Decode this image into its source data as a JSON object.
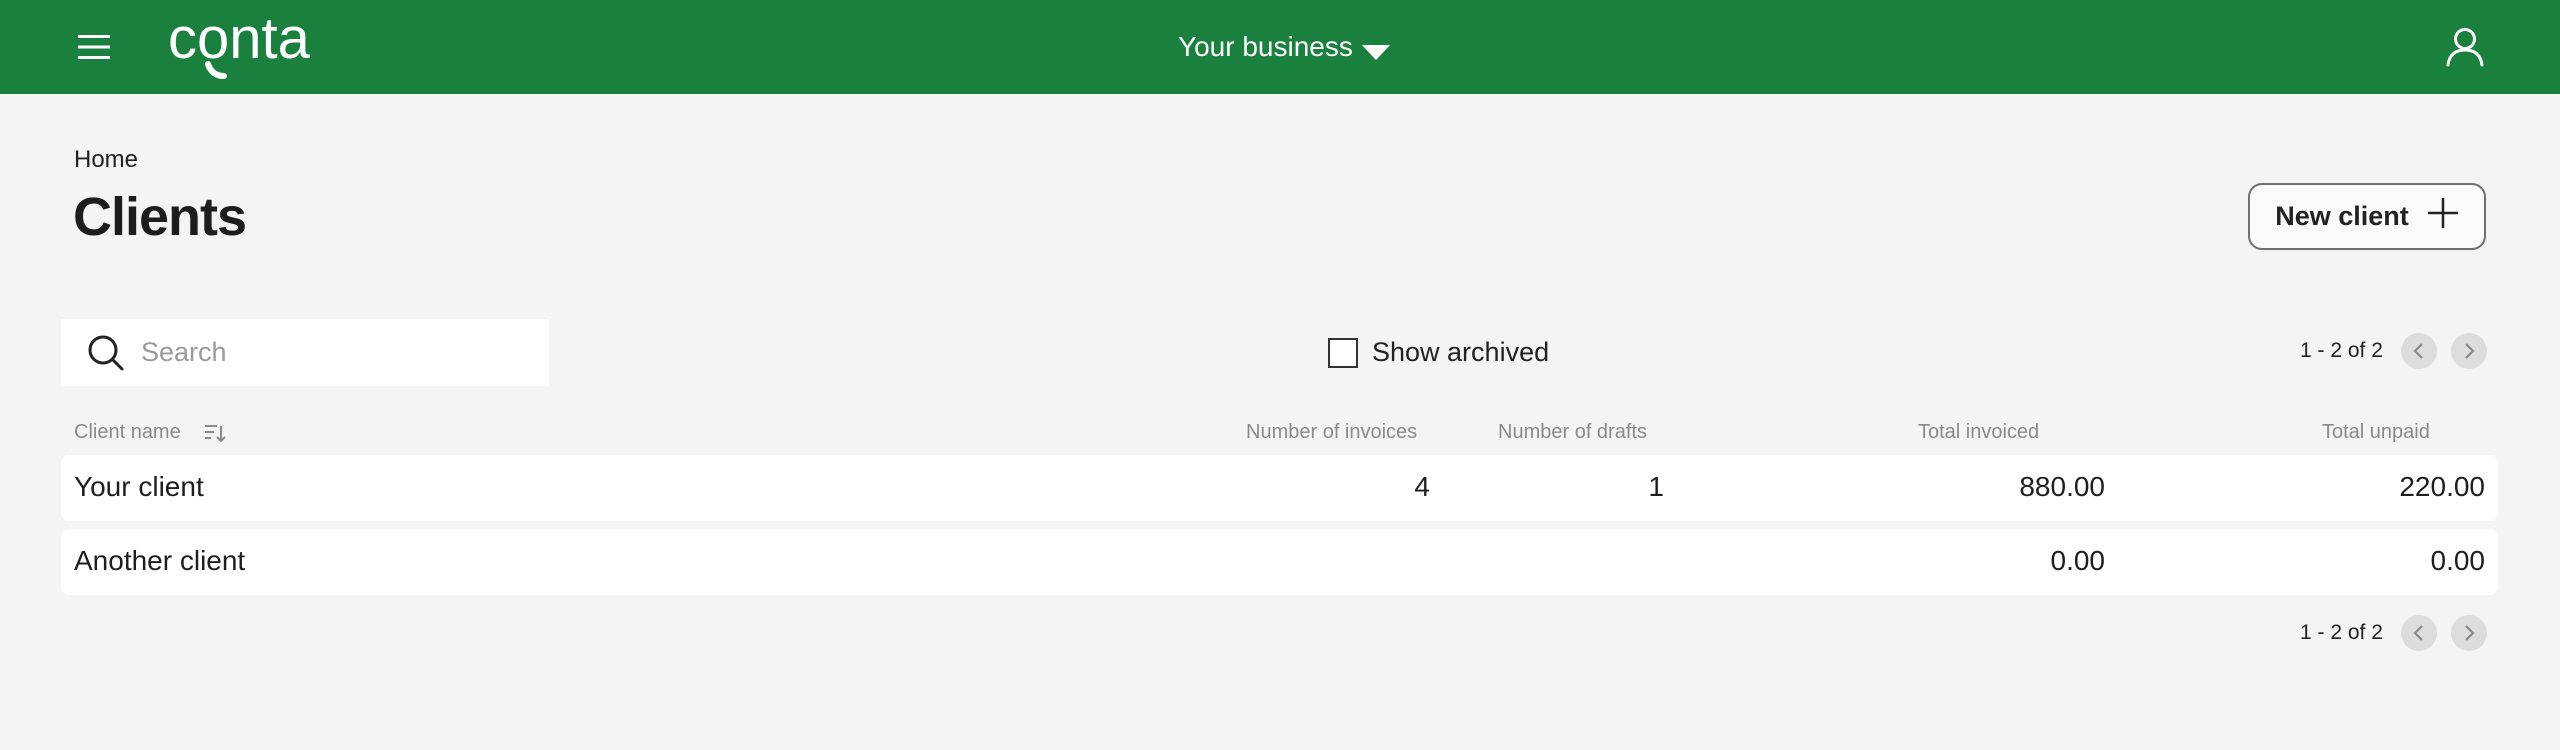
{
  "header": {
    "logo_text": "conta",
    "business_label": "Your business"
  },
  "breadcrumb": {
    "home": "Home"
  },
  "page": {
    "title": "Clients",
    "new_client_label": "New client"
  },
  "toolbar": {
    "search_placeholder": "Search",
    "show_archived_label": "Show archived",
    "pagination_label": "1 - 2 of 2"
  },
  "table": {
    "columns": {
      "client_name": "Client name",
      "num_invoices": "Number of invoices",
      "num_drafts": "Number of drafts",
      "total_invoiced": "Total invoiced",
      "total_unpaid": "Total unpaid"
    },
    "rows": [
      {
        "name": "Your client",
        "invoices": "4",
        "drafts": "1",
        "invoiced": "880.00",
        "unpaid": "220.00"
      },
      {
        "name": "Another client",
        "invoices": "",
        "drafts": "",
        "invoiced": "0.00",
        "unpaid": "0.00"
      }
    ]
  },
  "footer_pagination_label": "1 - 2 of 2",
  "colors": {
    "brand_green": "#19813d",
    "background": "#f4f4f4"
  },
  "icons": {
    "menu": "hamburger-icon",
    "account": "user-icon",
    "dropdown": "caret-down-icon",
    "search": "search-icon",
    "add": "plus-icon",
    "sort": "sort-icon",
    "prev": "chevron-left-icon",
    "next": "chevron-right-icon"
  }
}
